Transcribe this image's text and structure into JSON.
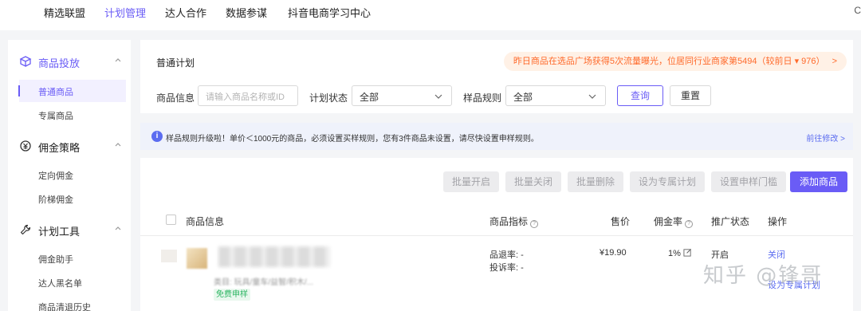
{
  "topnav": {
    "items": [
      "精选联盟",
      "计划管理",
      "达人合作",
      "数据参谋",
      "抖音电商学习中心"
    ],
    "active_index": 1,
    "edge": "C"
  },
  "sidebar": {
    "sections": [
      {
        "label": "商品投放",
        "icon": "box-icon",
        "active": true,
        "items": [
          {
            "label": "普通商品",
            "active": true
          },
          {
            "label": "专属商品",
            "active": false
          }
        ]
      },
      {
        "label": "佣金策略",
        "icon": "money-icon",
        "active": false,
        "items": [
          {
            "label": "定向佣金"
          },
          {
            "label": "阶梯佣金"
          }
        ]
      },
      {
        "label": "计划工具",
        "icon": "tool-icon",
        "active": false,
        "items": [
          {
            "label": "佣金助手"
          },
          {
            "label": "达人黑名单"
          },
          {
            "label": "商品清退历史"
          }
        ]
      }
    ]
  },
  "filter": {
    "title": "普通计划",
    "notice": "昨日商品在选品广场获得5次流量曝光，位居同行业商家第5494（较前日 ▾ 976）",
    "notice_arrow": ">",
    "product_info_label": "商品信息",
    "product_info_placeholder": "请输入商品名称或ID",
    "plan_status_label": "计划状态",
    "plan_status_value": "全部",
    "sample_rule_label": "样品规则",
    "sample_rule_value": "全部",
    "query_button": "查询",
    "reset_button": "重置"
  },
  "infobar": {
    "icon_text": "i",
    "text": "样品规则升级啦！单价＜1000元的商品，必须设置买样规则，您有3件商品未设置，请尽快设置申样规则。",
    "link": "前往修改 >"
  },
  "toolbar": {
    "batch_open": "批量开启",
    "batch_close": "批量关闭",
    "batch_delete": "批量删除",
    "set_exclusive": "设为专属计划",
    "set_sample_threshold": "设置申样门槛",
    "add_product": "添加商品"
  },
  "table": {
    "headers": {
      "product": "商品信息",
      "metric": "商品指标",
      "price": "售价",
      "commission": "佣金率",
      "status": "推广状态",
      "actions": "操作"
    },
    "rows": [
      {
        "category": "类目: 玩具/童车/益智/积木/...",
        "tag": "免费申样",
        "refund_rate": "品退率: -",
        "complaint_rate": "投诉率: -",
        "price": "¥19.90",
        "commission": "1%",
        "status": "开启",
        "action_close": "关闭",
        "action_more": "设为专属计划"
      }
    ]
  },
  "watermark": "知乎 @锋哥",
  "colors": {
    "accent": "#6a5cf6",
    "notice_text": "#ff6a2b",
    "notice_bg": "#fff1e6",
    "info_bg": "#eff2fb",
    "tag_green": "#2bb561"
  }
}
